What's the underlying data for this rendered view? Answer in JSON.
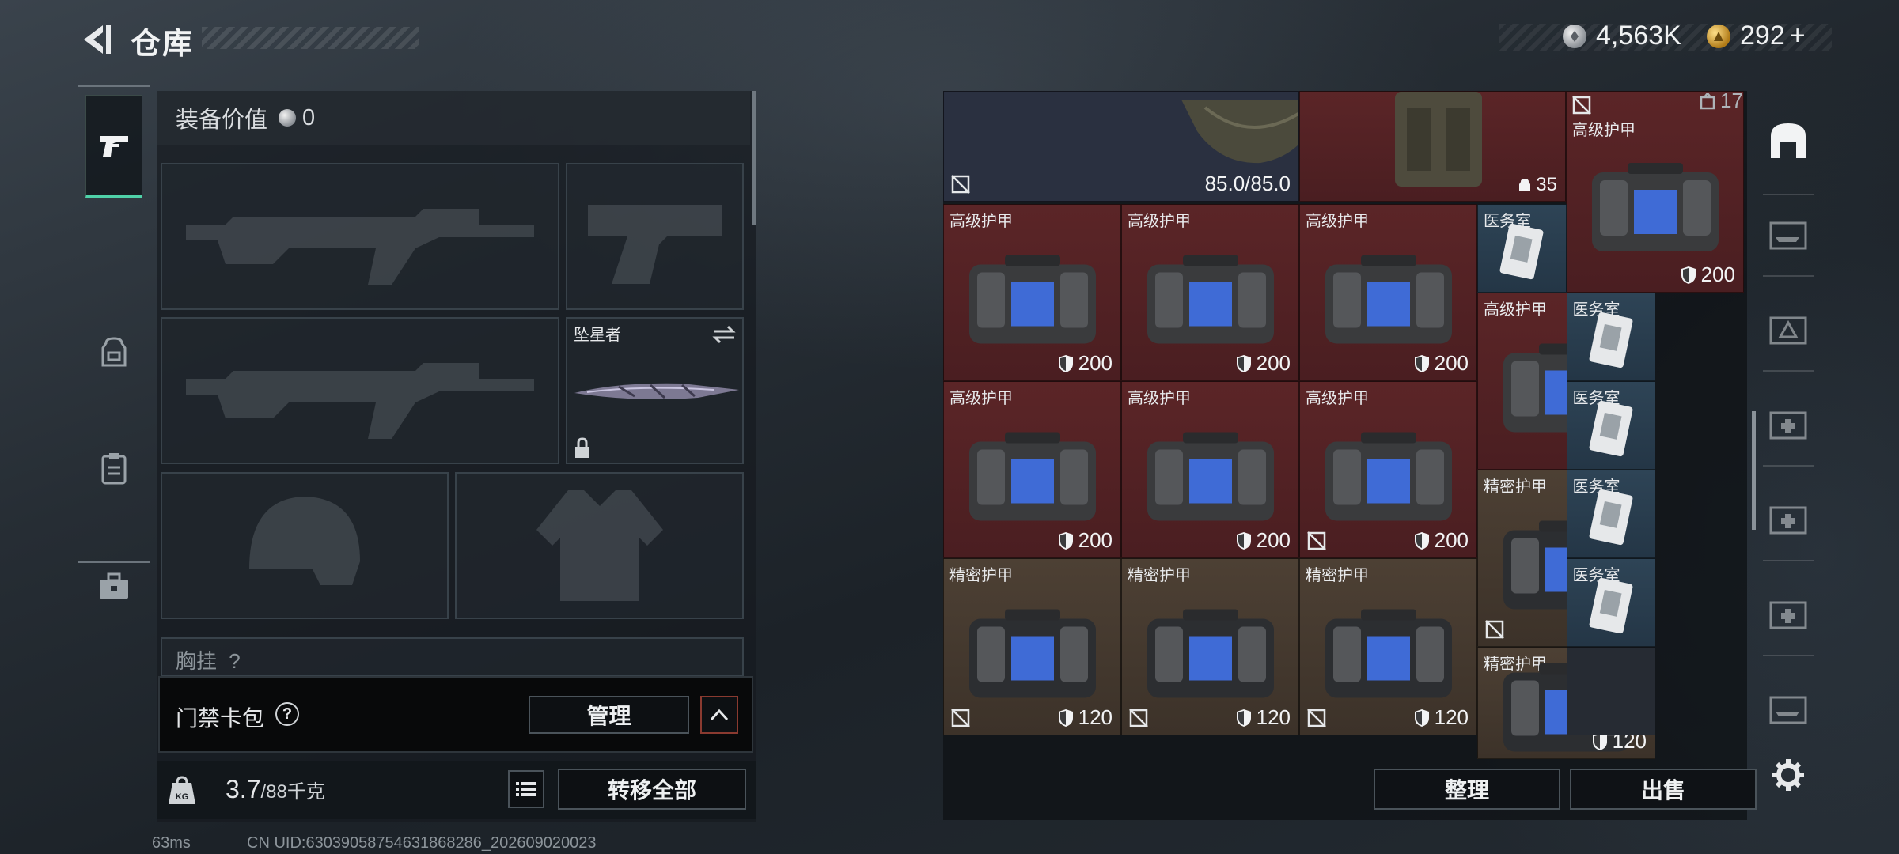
{
  "header": {
    "title": "仓库",
    "back_label": "back"
  },
  "currencies": [
    {
      "name": "silver-coin",
      "value": "4,563K"
    },
    {
      "name": "gold-coin",
      "value": "292",
      "suffix": "+"
    }
  ],
  "left_nav": {
    "tabs": [
      {
        "icon": "pistol-icon",
        "active": true
      },
      {
        "icon": "backpack-icon",
        "active": false
      },
      {
        "icon": "clipboard-icon",
        "active": false
      },
      {
        "icon": "toolbox-icon",
        "active": false
      }
    ]
  },
  "equipment": {
    "value_label": "装备价值",
    "value": "0",
    "melee_name": "坠星者",
    "chest_label": "胸挂",
    "chest_badge": "?"
  },
  "keycard": {
    "label": "门禁卡包",
    "help": "?",
    "manage_label": "管理"
  },
  "weight": {
    "current": "3.7",
    "max": "/88千克",
    "unit_badge": "KG",
    "transfer_all_label": "转移全部"
  },
  "inventory": {
    "counter": "17",
    "top_row": {
      "durability": "85.0/85.0",
      "backpack_count": "35"
    },
    "cells": [
      {
        "label": "高级护甲",
        "durability": "200"
      },
      {
        "label": "医务室",
        "durability": ""
      },
      {
        "label": "精密护甲",
        "durability": "120"
      }
    ],
    "sort_label": "整理",
    "sell_label": "出售"
  },
  "footer": {
    "ping": "63ms",
    "uid": "CN UID:63039058754631868286_202609020023"
  },
  "colors": {
    "accent": "#4fd1a8",
    "high_armor_bg": "#5b2527",
    "precise_armor_bg": "#4d4034",
    "medical_bg": "#2e4456"
  }
}
